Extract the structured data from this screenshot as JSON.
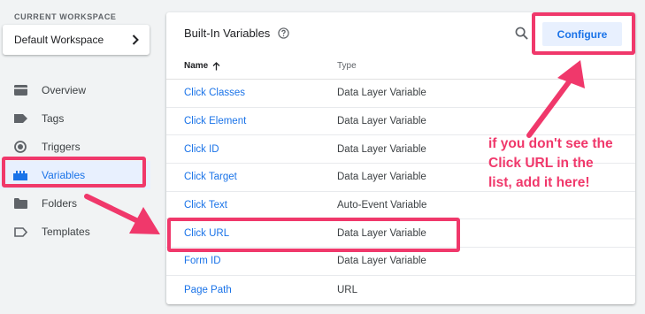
{
  "sidebar": {
    "workspace_label": "CURRENT WORKSPACE",
    "workspace_name": "Default Workspace",
    "items": [
      {
        "label": "Overview",
        "icon": "overview-icon"
      },
      {
        "label": "Tags",
        "icon": "tag-icon"
      },
      {
        "label": "Triggers",
        "icon": "trigger-icon"
      },
      {
        "label": "Variables",
        "icon": "variables-icon",
        "active": true
      },
      {
        "label": "Folders",
        "icon": "folder-icon"
      },
      {
        "label": "Templates",
        "icon": "template-icon"
      }
    ]
  },
  "main": {
    "title": "Built-In Variables",
    "configure_label": "Configure",
    "columns": {
      "name": "Name",
      "type": "Type"
    },
    "rows": [
      {
        "name": "Click Classes",
        "type": "Data Layer Variable"
      },
      {
        "name": "Click Element",
        "type": "Data Layer Variable"
      },
      {
        "name": "Click ID",
        "type": "Data Layer Variable"
      },
      {
        "name": "Click Target",
        "type": "Data Layer Variable"
      },
      {
        "name": "Click Text",
        "type": "Auto-Event Variable"
      },
      {
        "name": "Click URL",
        "type": "Data Layer Variable"
      },
      {
        "name": "Form ID",
        "type": "Data Layer Variable"
      },
      {
        "name": "Page Path",
        "type": "URL"
      }
    ]
  },
  "annotation": {
    "callout_text": "if you don't see the\nClick URL in the\nlist, add it here!",
    "color": "#f0386b"
  },
  "colors": {
    "accent": "#1a73e8",
    "active_bg": "#e8f0fe",
    "highlight": "#f0386b"
  }
}
